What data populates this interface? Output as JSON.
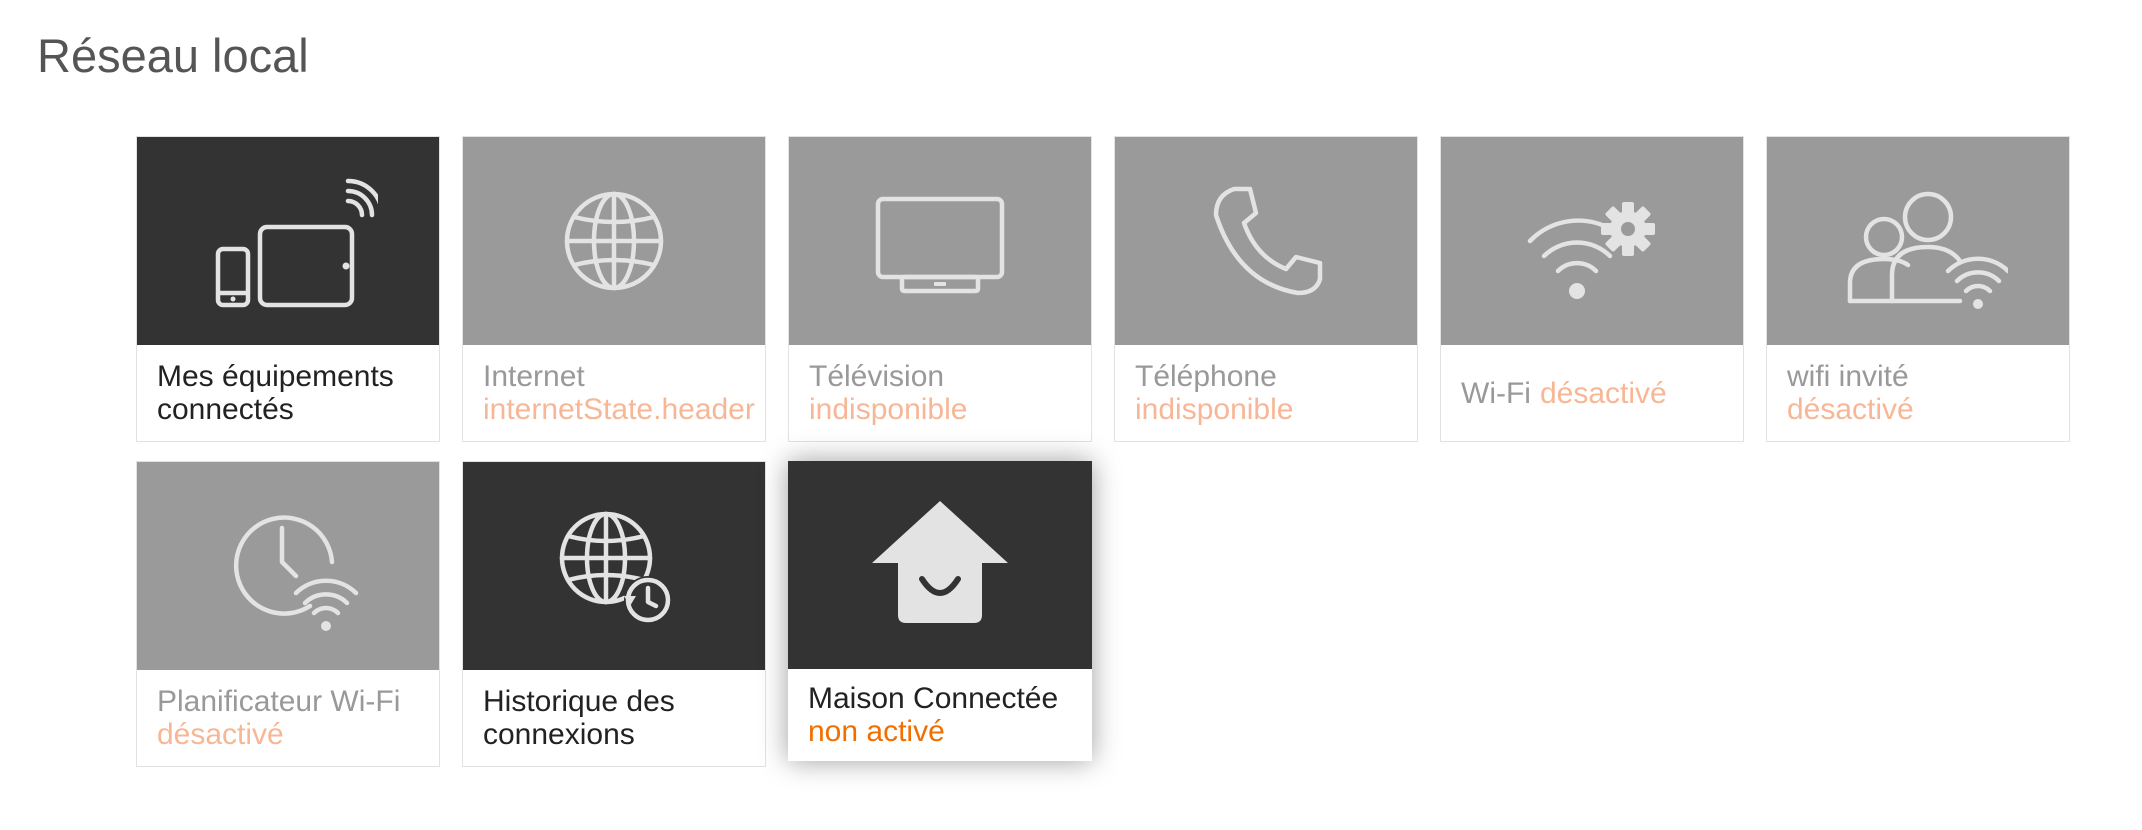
{
  "page": {
    "title": "Réseau local"
  },
  "colors": {
    "tile_dark": "#333333",
    "tile_disabled": "#9a9a9a",
    "status_faded": "#f7b796",
    "status_active": "#f16e00",
    "icon": "#e3e3e3"
  },
  "tiles": [
    {
      "id": "devices",
      "name": "Mes équipements",
      "name2": "connectés",
      "icon": "devices-wifi-icon"
    },
    {
      "id": "internet",
      "name": "Internet",
      "status": "internetState.header",
      "icon": "globe-icon"
    },
    {
      "id": "tv",
      "name": "Télévision",
      "status": "indisponible",
      "icon": "tv-icon"
    },
    {
      "id": "phone",
      "name": "Téléphone",
      "status": "indisponible",
      "icon": "phone-icon"
    },
    {
      "id": "wifi",
      "name": "Wi-Fi",
      "status": "désactivé",
      "icon": "wifi-settings-icon"
    },
    {
      "id": "guest-wifi",
      "name": "wifi invité",
      "status": "désactivé",
      "icon": "guest-wifi-icon"
    },
    {
      "id": "wifi-scheduler",
      "name": "Planificateur Wi-Fi",
      "status": "désactivé",
      "icon": "clock-wifi-icon"
    },
    {
      "id": "history",
      "name": "Historique des",
      "name2": "connexions",
      "icon": "globe-history-icon"
    },
    {
      "id": "smart-home",
      "name": "Maison Connectée",
      "status": "non activé",
      "icon": "smart-home-icon"
    }
  ]
}
